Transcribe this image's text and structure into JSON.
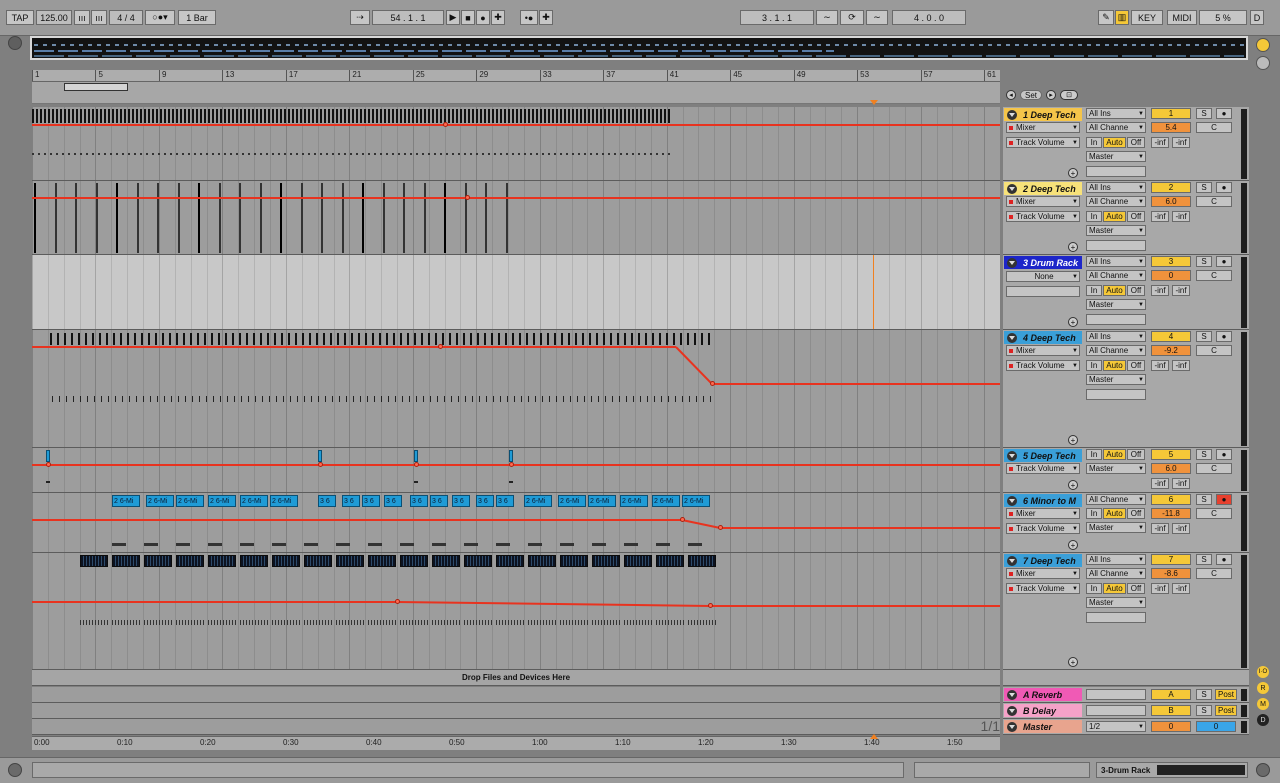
{
  "transport": {
    "tap_label": "TAP",
    "tempo": "125.00",
    "time_sig": "4 / 4",
    "quantize": "1 Bar",
    "position": "54 .  1 .  1",
    "loop_start": "3 .  1 .  1",
    "loop_length": "4 .  0 .  0",
    "key_label": "KEY",
    "midi_label": "MIDI",
    "cpu": "5 %",
    "d_label": "D"
  },
  "ruler": {
    "bars": [
      "1",
      "5",
      "9",
      "13",
      "17",
      "21",
      "25",
      "29",
      "33",
      "37",
      "41",
      "45",
      "49",
      "53",
      "57",
      "61"
    ],
    "set_label": "Set"
  },
  "time_ruler": [
    "0:00",
    "0:10",
    "0:20",
    "0:30",
    "0:40",
    "0:50",
    "1:00",
    "1:10",
    "1:20",
    "1:30",
    "1:40",
    "1:50"
  ],
  "tracks": [
    {
      "name": "1 Deep Tech",
      "color": "#f5c54a",
      "input": "All Ins",
      "channel": "All Channe",
      "device": "Mixer",
      "param": "Track Volume",
      "output": "Master",
      "num": "1",
      "vol": "5.4",
      "pan": "C",
      "peak1": "-inf",
      "peak2": "-inf",
      "mon_in": "In",
      "mon_auto": "Auto",
      "mon_off": "Off",
      "solo": "S"
    },
    {
      "name": "2 Deep Tech",
      "color": "#f7e27a",
      "input": "All Ins",
      "channel": "All Channe",
      "device": "Mixer",
      "param": "Track Volume",
      "output": "Master",
      "num": "2",
      "vol": "6.0",
      "pan": "C",
      "peak1": "-inf",
      "peak2": "-inf",
      "mon_in": "In",
      "mon_auto": "Auto",
      "mon_off": "Off",
      "solo": "S"
    },
    {
      "name": "3 Drum Rack",
      "color": "#1d26c9",
      "input": "All Ins",
      "channel": "All Channe",
      "device": "None",
      "param": "",
      "output": "Master",
      "num": "3",
      "vol": "0",
      "pan": "C",
      "peak1": "-inf",
      "peak2": "-inf",
      "mon_in": "In",
      "mon_auto": "Auto",
      "mon_off": "Off",
      "solo": "S"
    },
    {
      "name": "4 Deep Tech",
      "color": "#3a9fd8",
      "input": "All Ins",
      "channel": "All Channe",
      "device": "Mixer",
      "param": "Track Volume",
      "output": "Master",
      "num": "4",
      "vol": "-9.2",
      "pan": "C",
      "peak1": "-inf",
      "peak2": "-inf",
      "mon_in": "In",
      "mon_auto": "Auto",
      "mon_off": "Off",
      "solo": "S"
    },
    {
      "name": "5 Deep Tech",
      "color": "#3a9fd8",
      "input": "",
      "channel": "",
      "device": "Track Volume",
      "param": "",
      "output": "Master",
      "num": "5",
      "vol": "6.0",
      "pan": "C",
      "peak1": "-inf",
      "peak2": "-inf",
      "mon_in": "In",
      "mon_auto": "Auto",
      "mon_off": "Off",
      "solo": "S"
    },
    {
      "name": "6 Minor to M",
      "color": "#3a9fd8",
      "input": "",
      "channel": "All Channe",
      "device": "Mixer",
      "param": "Track Volume",
      "output": "Master",
      "num": "6",
      "vol": "-11.8",
      "pan": "C",
      "peak1": "-inf",
      "peak2": "-inf",
      "mon_in": "In",
      "mon_auto": "Auto",
      "mon_off": "Off",
      "solo": "S"
    },
    {
      "name": "7 Deep Tech",
      "color": "#3a9fd8",
      "input": "All Ins",
      "channel": "All Channe",
      "device": "Mixer",
      "param": "Track Volume",
      "output": "Master",
      "num": "7",
      "vol": "-8.6",
      "pan": "C",
      "peak1": "-inf",
      "peak2": "-inf",
      "mon_in": "In",
      "mon_auto": "Auto",
      "mon_off": "Off",
      "solo": "S"
    }
  ],
  "clip_label": "2 6-Mi",
  "clip_label_b": "3 6",
  "drop_label": "Drop Files and Devices Here",
  "returns": [
    {
      "name": "A Reverb",
      "color": "#f05ab5",
      "num": "A",
      "solo": "S",
      "post": "Post"
    },
    {
      "name": "B Delay",
      "color": "#f5a2c8",
      "num": "B",
      "solo": "S",
      "post": "Post"
    },
    {
      "name": "Master",
      "color": "#e8a48e",
      "num": "0",
      "io": "1/2",
      "vol": "0"
    }
  ],
  "page_indicator": "1/1",
  "status": {
    "device_label": "3-Drum Rack"
  },
  "sidebar": {
    "io": "I·O",
    "r": "R",
    "m": "M",
    "d": "D"
  }
}
